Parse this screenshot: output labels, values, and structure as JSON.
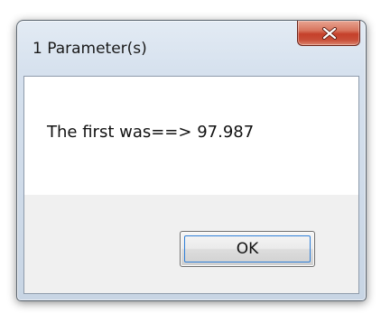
{
  "window": {
    "title": "1 Parameter(s)",
    "close_icon": "close-x-icon"
  },
  "message": {
    "text": "The first was==> 97.987"
  },
  "buttons": {
    "ok_label": "OK"
  },
  "colors": {
    "title_bar": "#d6e1ee",
    "close_button": "#c5402a",
    "footer": "#f0f0f0",
    "focus_ring": "#2f7fd8"
  }
}
